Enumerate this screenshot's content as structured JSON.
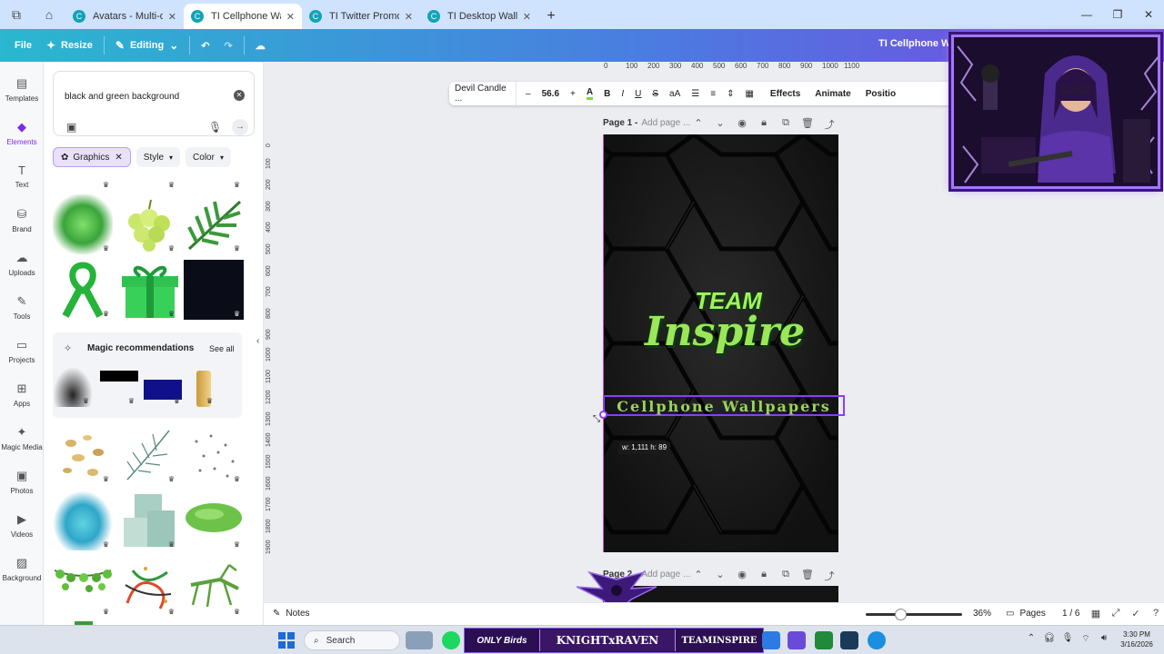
{
  "browser": {
    "tabs": [
      {
        "label": "Avatars - Multi-des...",
        "active": false
      },
      {
        "label": "TI Cellphone Wallp...",
        "active": true
      },
      {
        "label": "TI Twitter Promo - ...",
        "active": false
      },
      {
        "label": "TI Desktop Wallpape...",
        "active": false
      }
    ]
  },
  "header": {
    "file": "File",
    "resize": "Resize",
    "editing": "Editing",
    "title": "TI Cellphone Wall",
    "accent_start": "#2ab7cf",
    "accent_end": "#7a45e0"
  },
  "rail": {
    "items": [
      {
        "label": "Templates",
        "icon": "templates-icon"
      },
      {
        "label": "Elements",
        "icon": "elements-icon",
        "active": true
      },
      {
        "label": "Text",
        "icon": "text-icon"
      },
      {
        "label": "Brand",
        "icon": "brand-icon"
      },
      {
        "label": "Uploads",
        "icon": "uploads-icon"
      },
      {
        "label": "Tools",
        "icon": "tools-icon"
      },
      {
        "label": "Projects",
        "icon": "projects-icon"
      },
      {
        "label": "Apps",
        "icon": "apps-icon"
      },
      {
        "label": "Magic Media",
        "icon": "magic-media-icon"
      },
      {
        "label": "Photos",
        "icon": "photos-icon"
      },
      {
        "label": "Videos",
        "icon": "videos-icon"
      },
      {
        "label": "Background",
        "icon": "background-icon"
      }
    ]
  },
  "panel": {
    "search_value": "black and green background",
    "chips": {
      "graphics": "Graphics",
      "style": "Style",
      "color": "Color"
    },
    "magic_title": "Magic recommendations",
    "see_all": "See all"
  },
  "canvas": {
    "ruler_h": [
      "0",
      "100",
      "200",
      "300",
      "400",
      "500",
      "600",
      "700",
      "800",
      "900",
      "1000",
      "1100"
    ],
    "ruler_v": [
      "0",
      "100",
      "200",
      "300",
      "400",
      "500",
      "600",
      "700",
      "800",
      "900",
      "1000",
      "1100",
      "1200",
      "1300",
      "1400",
      "1500",
      "1600",
      "1700",
      "1800",
      "1900"
    ],
    "toolbar": {
      "font": "Devil Candle ...",
      "minus": "–",
      "size": "56.6",
      "plus": "+",
      "effects": "Effects",
      "animate": "Animate",
      "position": "Positio"
    },
    "page1": {
      "label": "Page 1 -",
      "add_title": "Add page ..."
    },
    "page2": {
      "label": "Page 2 -",
      "add_title": "Add page ..."
    },
    "logo_team": "TEAM",
    "logo_inspire": "Inspire",
    "selected_text": "Cellphone Wallpapers",
    "dimensions_tip": "w: 1,111 h: 89"
  },
  "bottom": {
    "notes": "Notes",
    "zoom": "36%",
    "zoom_level": 0.36,
    "pages": "Pages",
    "page_count": "1 / 6"
  },
  "taskbar": {
    "search": "Search",
    "banner_left": "ONLY Birds",
    "banner_mid": "KNIGHTxRAVEN",
    "banner_right": "TEAMINSPIRE",
    "time": "3:30 PM",
    "date": "3/16/2026"
  }
}
